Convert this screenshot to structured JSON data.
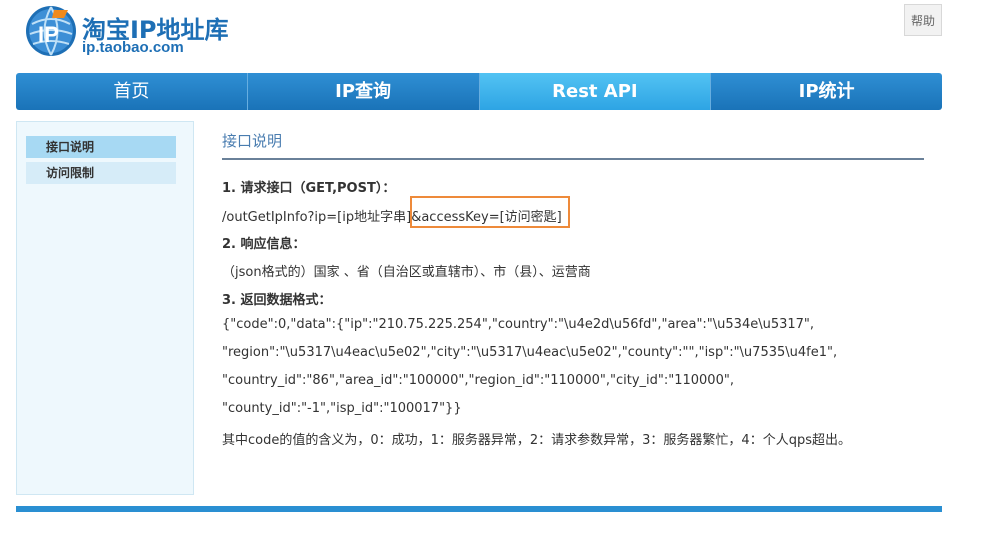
{
  "header": {
    "logo_title": "淘宝IP地址库",
    "logo_domain": "ip.taobao.com",
    "help_label": "帮助"
  },
  "nav": {
    "tabs": [
      {
        "label": "首页"
      },
      {
        "label": "IP查询"
      },
      {
        "label": "Rest API"
      },
      {
        "label": "IP统计"
      }
    ],
    "active_index": 2
  },
  "sidebar": {
    "items": [
      {
        "label": "接口说明"
      },
      {
        "label": "访问限制"
      }
    ]
  },
  "content": {
    "title": "接口说明",
    "h1": "1. 请求接口（GET,POST）：",
    "endpoint": "/outGetIpInfo?ip=[ip地址字串]&accessKey=[访问密匙]",
    "h2": "2. 响应信息：",
    "response_desc": "（json格式的）国家 、省（自治区或直辖市）、市（县）、运营商",
    "h3": "3. 返回数据格式：",
    "json_lines": [
      "{\"code\":0,\"data\":{\"ip\":\"210.75.225.254\",\"country\":\"\\u4e2d\\u56fd\",\"area\":\"\\u534e\\u5317\",",
      "\"region\":\"\\u5317\\u4eac\\u5e02\",\"city\":\"\\u5317\\u4eac\\u5e02\",\"county\":\"\",\"isp\":\"\\u7535\\u4fe1\",",
      "\"country_id\":\"86\",\"area_id\":\"100000\",\"region_id\":\"110000\",\"city_id\":\"110000\",",
      "\"county_id\":\"-1\",\"isp_id\":\"100017\"}}"
    ],
    "code_meaning": "其中code的值的含义为，0：成功，1：服务器异常，2：请求参数异常，3：服务器繁忙，4：个人qps超出。"
  },
  "colors": {
    "nav_blue": "#1a73b8",
    "nav_active": "#2ea4e4",
    "highlight_orange": "#ee8a3a",
    "title_blue": "#4a7db0"
  }
}
